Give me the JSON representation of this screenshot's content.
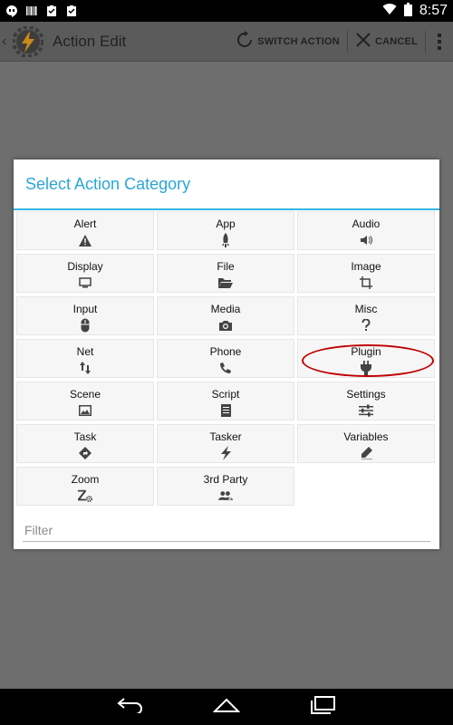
{
  "status_bar": {
    "time": "8:57",
    "left_icons": [
      "hangouts-icon",
      "barcode-icon",
      "clipboard-check-icon",
      "clipboard-check-icon"
    ],
    "right_icons": [
      "wifi-icon",
      "battery-icon"
    ]
  },
  "action_bar": {
    "title": "Action Edit",
    "switch_action": "SWITCH ACTION",
    "cancel": "CANCEL"
  },
  "dialog": {
    "title": "Select Action Category",
    "filter_placeholder": "Filter",
    "categories": [
      {
        "label": "Alert",
        "icon": "warning-icon"
      },
      {
        "label": "App",
        "icon": "rocket-icon"
      },
      {
        "label": "Audio",
        "icon": "speaker-icon"
      },
      {
        "label": "Display",
        "icon": "monitor-icon"
      },
      {
        "label": "File",
        "icon": "folder-icon"
      },
      {
        "label": "Image",
        "icon": "crop-icon"
      },
      {
        "label": "Input",
        "icon": "mouse-icon"
      },
      {
        "label": "Media",
        "icon": "camera-icon"
      },
      {
        "label": "Misc",
        "icon": "question-icon"
      },
      {
        "label": "Net",
        "icon": "up-down-arrows-icon"
      },
      {
        "label": "Phone",
        "icon": "phone-icon"
      },
      {
        "label": "Plugin",
        "icon": "plug-icon"
      },
      {
        "label": "Scene",
        "icon": "picture-icon"
      },
      {
        "label": "Script",
        "icon": "document-icon"
      },
      {
        "label": "Settings",
        "icon": "sliders-icon"
      },
      {
        "label": "Task",
        "icon": "diamond-arrow-icon"
      },
      {
        "label": "Tasker",
        "icon": "lightning-icon"
      },
      {
        "label": "Variables",
        "icon": "pencil-icon"
      },
      {
        "label": "Zoom",
        "icon": "zoom-gear-icon"
      },
      {
        "label": "3rd Party",
        "icon": "people-icon"
      }
    ]
  },
  "colors": {
    "accent": "#33b5e5",
    "title_text": "#2ba6d6",
    "highlight_ring": "#c00000"
  }
}
